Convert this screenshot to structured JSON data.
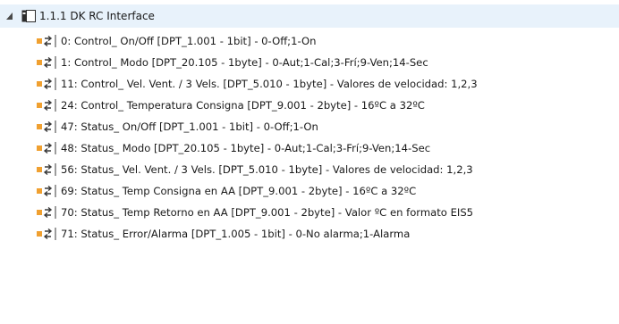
{
  "tree": {
    "root": {
      "label": "1.1.1  DK RC Interface",
      "expanded": true
    },
    "objects": [
      {
        "label": "0: Control_ On/Off [DPT_1.001 - 1bit] - 0-Off;1-On"
      },
      {
        "label": "1: Control_ Modo [DPT_20.105 - 1byte] - 0-Aut;1-Cal;3-Frí;9-Ven;14-Sec"
      },
      {
        "label": "11: Control_ Vel. Vent. / 3 Vels. [DPT_5.010 - 1byte]  - Valores de velocidad: 1,2,3"
      },
      {
        "label": "24: Control_ Temperatura Consigna [DPT_9.001 - 2byte] - 16ºC a 32ºC"
      },
      {
        "label": "47: Status_ On/Off [DPT_1.001 - 1bit] - 0-Off;1-On"
      },
      {
        "label": "48: Status_ Modo [DPT_20.105 - 1byte] - 0-Aut;1-Cal;3-Frí;9-Ven;14-Sec"
      },
      {
        "label": "56: Status_ Vel. Vent. / 3 Vels. [DPT_5.010 - 1byte] - Valores de velocidad: 1,2,3"
      },
      {
        "label": "69: Status_ Temp Consigna en AA [DPT_9.001 - 2byte] - 16ºC a 32ºC"
      },
      {
        "label": "70: Status_ Temp Retorno en AA [DPT_9.001 - 2byte] - Valor ºC en formato EIS5"
      },
      {
        "label": "71: Status_ Error/Alarma [DPT_1.005 - 1bit] - 0-No alarma;1-Alarma"
      }
    ]
  },
  "icons": {
    "expander": "expanded-triangle-icon",
    "device": "knx-device-icon",
    "object": "group-object-icon"
  },
  "colors": {
    "selection_bg": "#e8f2fb",
    "object_icon_orange": "#f0a030",
    "text": "#1a1a1a"
  }
}
